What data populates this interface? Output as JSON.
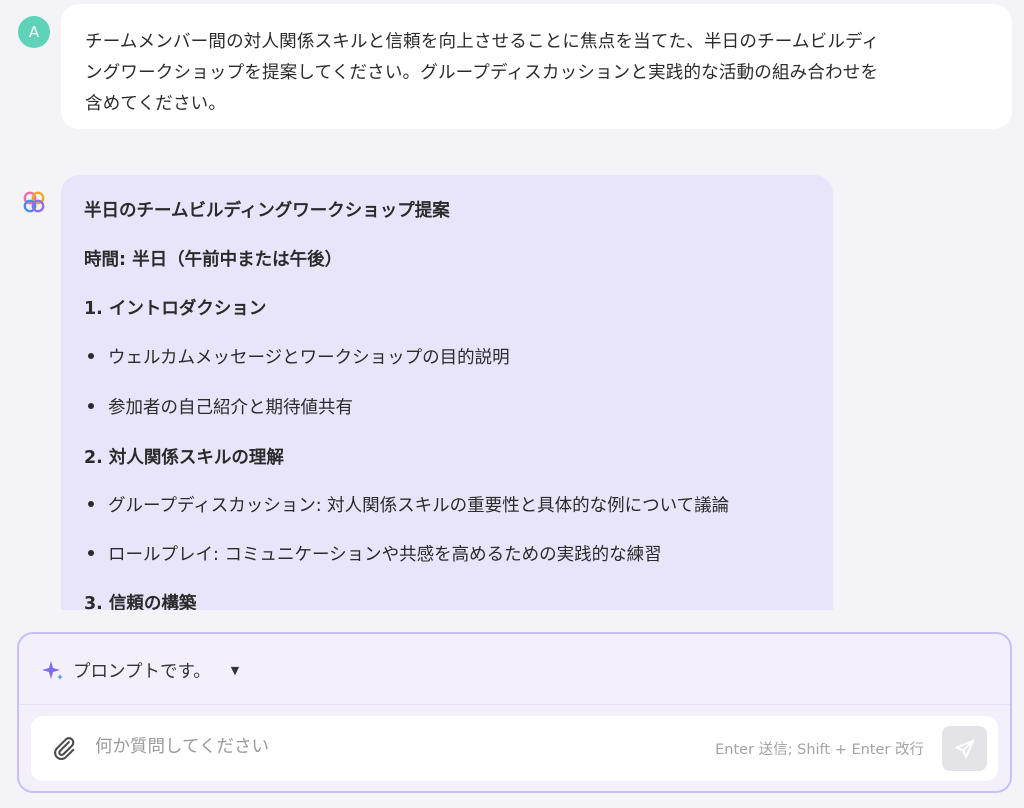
{
  "user_message": {
    "avatar_letter": "A",
    "avatar_color": "#5fd3b8",
    "lines": [
      "チームメンバー間の対人関係スキルと信頼を向上させることに焦点を当てた、半日のチームビルディ",
      "ングワークショップを提案してください。グループディスカッションと実践的な活動の組み合わせを",
      "含めてください。"
    ]
  },
  "assistant_message": {
    "avatar_icon": "assistant-logo-icon",
    "bubble_color": "#e8e5fa",
    "title": "半日のチームビルディングワークショップ提案",
    "duration": "時間: 半日（午前中または午後）",
    "sections": [
      {
        "heading": "1. イントロダクション",
        "bullets": [
          "ウェルカムメッセージとワークショップの目的説明",
          "参加者の自己紹介と期待値共有"
        ]
      },
      {
        "heading": "2. 対人関係スキルの理解",
        "bullets": [
          "グループディスカッション: 対人関係スキルの重要性と具体的な例について議論",
          "ロールプレイ: コミュニケーションや共感を高めるための実践的な練習"
        ]
      },
      {
        "heading": "3. 信頼の構築",
        "bullets": []
      }
    ]
  },
  "composer": {
    "prompt_selector_label": "プロンプトです。",
    "prompt_icon": "sparkle-icon",
    "input_placeholder": "何か質問してください",
    "input_value": "",
    "shortcut_hint": "Enter 送信; Shift + Enter 改行",
    "attach_icon": "paperclip-icon",
    "send_icon": "send-icon",
    "accent_color": "#c9c0f5"
  }
}
